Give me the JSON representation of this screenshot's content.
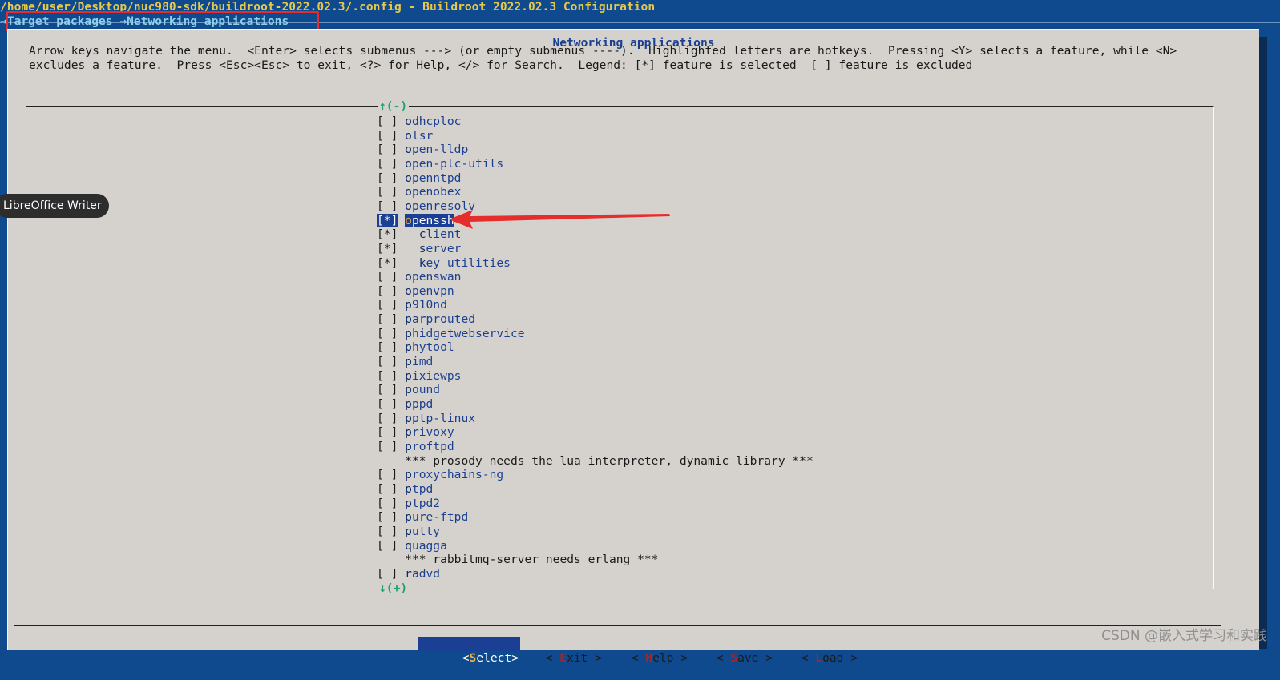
{
  "window": {
    "title": "/home/user/Desktop/nuc980-sdk/buildroot-2022.02.3/.config - Buildroot 2022.02.3 Configuration",
    "breadcrumb": "→Target packages →Networking applications"
  },
  "dialog": {
    "title": "Networking applications",
    "help_line_1": "Arrow keys navigate the menu.  <Enter> selects submenus ---> (or empty submenus ----).  Highlighted letters are hotkeys.  Pressing <Y> selects a feature, while <N>",
    "help_line_2": "excludes a feature.  Press <Esc><Esc> to exit, <?> for Help, </> for Search.  Legend: [*] feature is selected  [ ] feature is excluded",
    "scroll_up": "↑(-)",
    "scroll_down": "↓(+)"
  },
  "menu": {
    "items": [
      {
        "checkbox": "[ ]",
        "hotkey": "o",
        "rest": "dhcploc"
      },
      {
        "checkbox": "[ ]",
        "hotkey": "o",
        "rest": "lsr"
      },
      {
        "checkbox": "[ ]",
        "hotkey": "o",
        "rest": "pen-lldp"
      },
      {
        "checkbox": "[ ]",
        "hotkey": "o",
        "rest": "pen-plc-utils"
      },
      {
        "checkbox": "[ ]",
        "hotkey": "o",
        "rest": "penntpd"
      },
      {
        "checkbox": "[ ]",
        "hotkey": "o",
        "rest": "penobex"
      },
      {
        "checkbox": "[ ]",
        "hotkey": "o",
        "rest": "penresolv"
      },
      {
        "checkbox": "[*]",
        "hotkey": "o",
        "rest": "penssh",
        "selected": true
      },
      {
        "checkbox": "[*]",
        "hotkey": "  c",
        "rest": "lient"
      },
      {
        "checkbox": "[*]",
        "hotkey": "  s",
        "rest": "erver"
      },
      {
        "checkbox": "[*]",
        "hotkey": "  k",
        "rest": "ey utilities"
      },
      {
        "checkbox": "[ ]",
        "hotkey": "o",
        "rest": "penswan"
      },
      {
        "checkbox": "[ ]",
        "hotkey": "o",
        "rest": "penvpn"
      },
      {
        "checkbox": "[ ]",
        "hotkey": "p",
        "rest": "910nd"
      },
      {
        "checkbox": "[ ]",
        "hotkey": "p",
        "rest": "arprouted"
      },
      {
        "checkbox": "[ ]",
        "hotkey": "p",
        "rest": "hidgetwebservice"
      },
      {
        "checkbox": "[ ]",
        "hotkey": "p",
        "rest": "hytool"
      },
      {
        "checkbox": "[ ]",
        "hotkey": "p",
        "rest": "imd"
      },
      {
        "checkbox": "[ ]",
        "hotkey": "p",
        "rest": "ixiewps"
      },
      {
        "checkbox": "[ ]",
        "hotkey": "p",
        "rest": "ound"
      },
      {
        "checkbox": "[ ]",
        "hotkey": "p",
        "rest": "ppd"
      },
      {
        "checkbox": "[ ]",
        "hotkey": "p",
        "rest": "ptp-linux"
      },
      {
        "checkbox": "[ ]",
        "hotkey": "p",
        "rest": "rivoxy"
      },
      {
        "checkbox": "[ ]",
        "hotkey": "p",
        "rest": "roftpd"
      },
      {
        "checkbox": "   ",
        "comment": "*** prosody needs the lua interpreter, dynamic library ***"
      },
      {
        "checkbox": "[ ]",
        "hotkey": "p",
        "rest": "roxychains-ng"
      },
      {
        "checkbox": "[ ]",
        "hotkey": "p",
        "rest": "tpd"
      },
      {
        "checkbox": "[ ]",
        "hotkey": "p",
        "rest": "tpd2"
      },
      {
        "checkbox": "[ ]",
        "hotkey": "p",
        "rest": "ure-ftpd"
      },
      {
        "checkbox": "[ ]",
        "hotkey": "p",
        "rest": "utty"
      },
      {
        "checkbox": "[ ]",
        "hotkey": "q",
        "rest": "uagga"
      },
      {
        "checkbox": "   ",
        "comment": "*** rabbitmq-server needs erlang ***"
      },
      {
        "checkbox": "[ ]",
        "hotkey": "r",
        "rest": "advd"
      }
    ]
  },
  "buttons": {
    "select": {
      "pre": "<",
      "hotkey": "S",
      "rest": "elect>"
    },
    "exit": {
      "pre": "< ",
      "hotkey": "E",
      "rest": "xit >"
    },
    "help": {
      "pre": "< ",
      "hotkey": "H",
      "rest": "elp >"
    },
    "save": {
      "pre": "< ",
      "hotkey": "S",
      "rest": "ave >"
    },
    "load": {
      "pre": "< ",
      "hotkey": "L",
      "rest": "oad >"
    }
  },
  "overlay": {
    "tooltip": "LibreOffice Writer",
    "watermark": "CSDN @嵌入式学习和实践"
  },
  "colors": {
    "terminal_bg": "#0f4a8f",
    "dialog_bg": "#d5d2cd",
    "selection": "#1b3f92",
    "annotation": "#e62d2d",
    "scroll_indicator": "#1ba36a"
  }
}
